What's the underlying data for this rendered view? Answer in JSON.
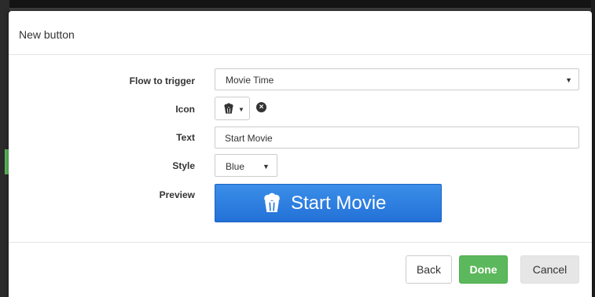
{
  "modal": {
    "title": "New button"
  },
  "form": {
    "flow_label": "Flow to trigger",
    "flow_value": "Movie Time",
    "icon_label": "Icon",
    "icon_name": "popcorn-icon",
    "clear_icon_name": "clear-circle-icon",
    "text_label": "Text",
    "text_value": "Start Movie",
    "style_label": "Style",
    "style_value": "Blue",
    "preview_label": "Preview"
  },
  "preview": {
    "label": "Start Movie",
    "color": "#2b7de0"
  },
  "footer": {
    "back_label": "Back",
    "done_label": "Done",
    "cancel_label": "Cancel"
  },
  "colors": {
    "done": "#5cb85c",
    "preview_blue": "#2b7de0",
    "cancel_bg": "#e6e6e6"
  }
}
